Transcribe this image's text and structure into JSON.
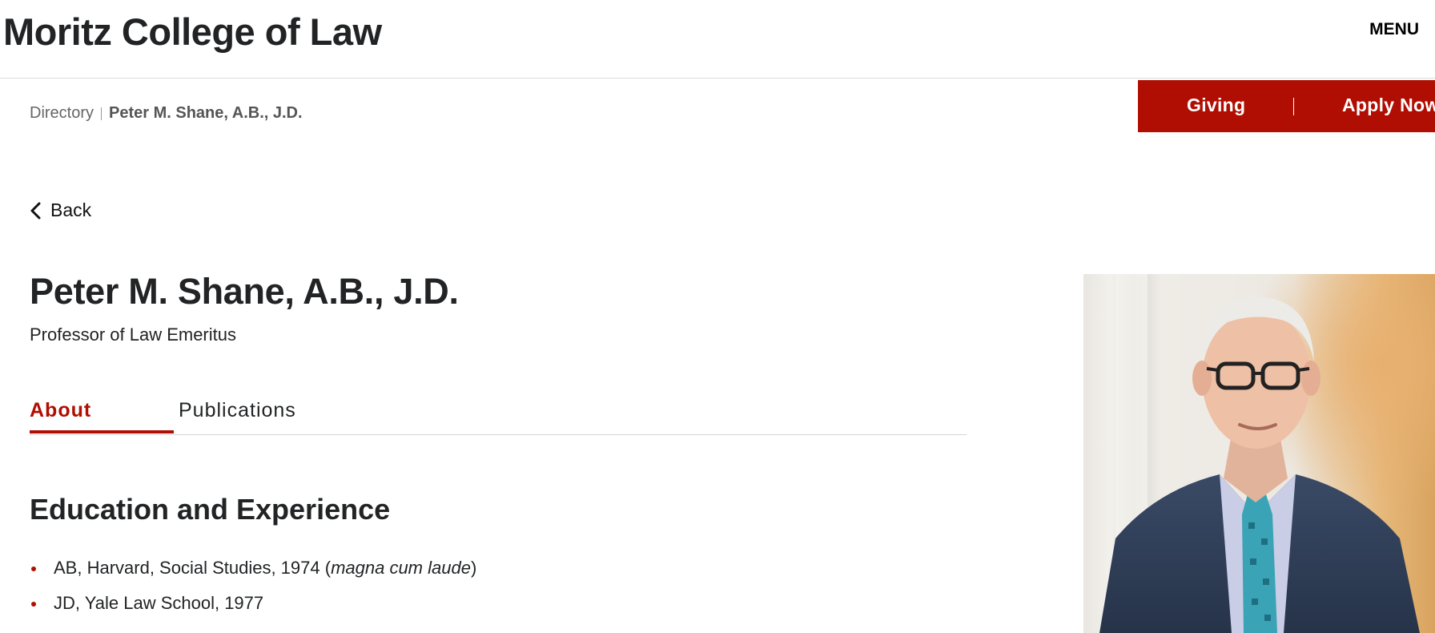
{
  "header": {
    "site_title": "Moritz College of Law",
    "menu_label": "MENU"
  },
  "breadcrumb": {
    "items": [
      "Directory",
      "Peter M. Shane, A.B., J.D."
    ]
  },
  "cta": {
    "giving_label": "Giving",
    "apply_label": "Apply Now",
    "background_color": "#b00e02"
  },
  "back": {
    "label": "Back",
    "icon": "chevron-left-icon"
  },
  "profile": {
    "name": "Peter M. Shane, A.B., J.D.",
    "title": "Professor of Law Emeritus"
  },
  "tabs": {
    "items": [
      {
        "label": "About",
        "active": true
      },
      {
        "label": "Publications",
        "active": false
      }
    ],
    "accent_color": "#b00e02"
  },
  "education": {
    "heading": "Education and Experience",
    "items": [
      {
        "text_before": "AB, Harvard, Social Studies, 1974 (",
        "italic": "magna cum laude",
        "text_after": ")"
      },
      {
        "text_before": "JD, Yale Law School, 1977",
        "italic": "",
        "text_after": ""
      }
    ]
  }
}
